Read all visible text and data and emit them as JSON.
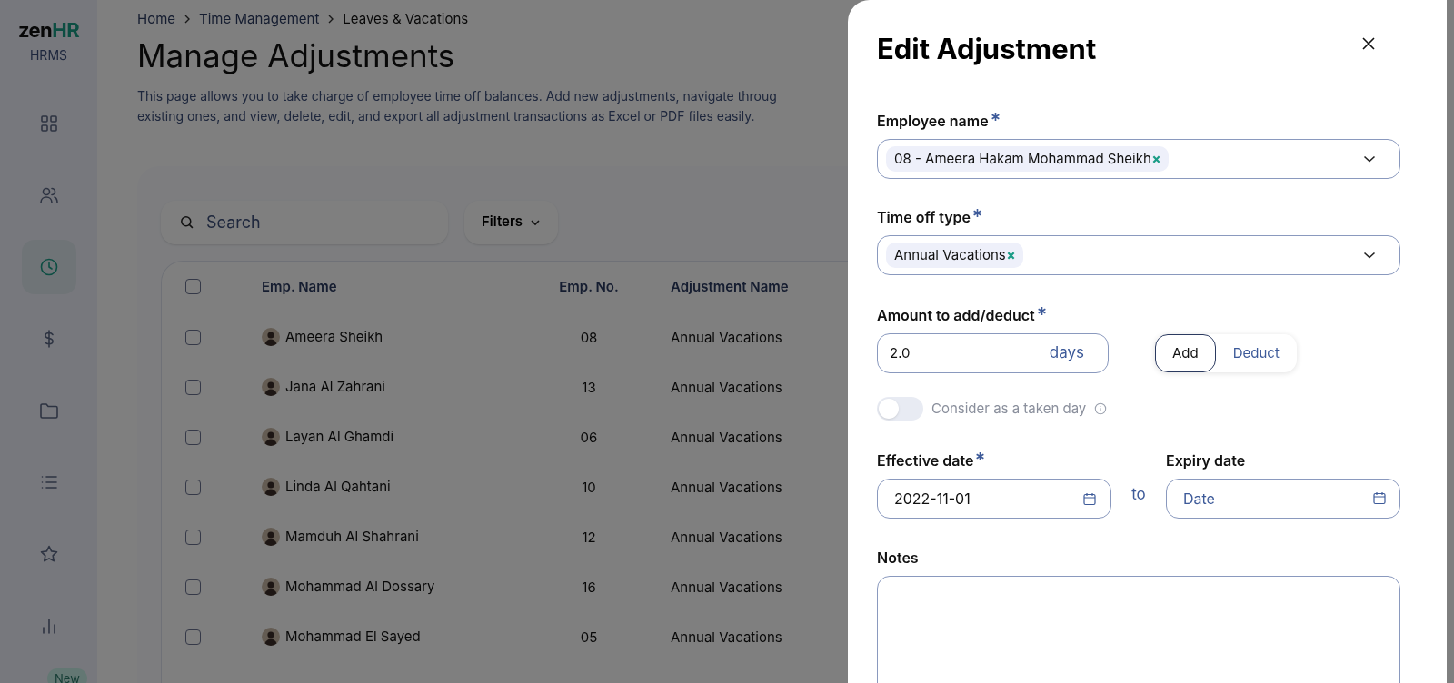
{
  "sidebar": {
    "logo": {
      "brand_dark": "zen",
      "brand_accent": "HR",
      "subtitle": "HRMS"
    },
    "items": [
      {
        "kind": "grid",
        "selected": false
      },
      {
        "kind": "people",
        "selected": false
      },
      {
        "kind": "clock",
        "selected": true
      },
      {
        "kind": "dollar",
        "selected": false
      },
      {
        "kind": "folder",
        "selected": false
      },
      {
        "kind": "list",
        "selected": false
      },
      {
        "kind": "star",
        "selected": false
      },
      {
        "kind": "chart",
        "selected": false
      }
    ],
    "badge": "New"
  },
  "breadcrumb": [
    "Home",
    "Time Management",
    "Leaves & Vacations"
  ],
  "page_title": "Manage Adjustments",
  "description": "This page allows you to take charge of employee time off balances. Add new adjustments, navigate throug\nexisting ones, and view, delete, edit, and export all adjustment transactions as Excel or PDF files easily.",
  "search": {
    "placeholder": "Search"
  },
  "filters_button": "Filters",
  "table": {
    "select_all_checked": false,
    "columns": [
      "Emp. Name",
      "Emp. No.",
      "Adjustment Name"
    ],
    "rows": [
      {
        "name": "Ameera Sheikh",
        "number": "08",
        "adjustment": "Annual Vacations",
        "checked": false
      },
      {
        "name": "Jana Al Zahrani",
        "number": "13",
        "adjustment": "Annual Vacations",
        "checked": false
      },
      {
        "name": "Layan Al Ghamdi",
        "number": "06",
        "adjustment": "Annual Vacations",
        "checked": false
      },
      {
        "name": "Linda Al Qahtani",
        "number": "10",
        "adjustment": "Annual Vacations",
        "checked": false
      },
      {
        "name": "Mamduh Al Shahrani",
        "number": "12",
        "adjustment": "Annual Vacations",
        "checked": false
      },
      {
        "name": "Mohammad Al Dossary",
        "number": "16",
        "adjustment": "Annual Vacations",
        "checked": false
      },
      {
        "name": "Mohammad El Sayed",
        "number": "05",
        "adjustment": "Annual Vacations",
        "checked": false
      }
    ]
  },
  "drawer": {
    "title": "Edit Adjustment",
    "employee": {
      "label": "Employee name",
      "required": true,
      "tag": "08 - Ameera Hakam Mohammad Sheikh"
    },
    "time_off_type": {
      "label": "Time off type",
      "required": true,
      "tag": "Annual Vacations"
    },
    "amount": {
      "label": "Amount to add/deduct",
      "required": true,
      "value": "2.0",
      "unit": "days"
    },
    "mode": [
      {
        "label": "Add",
        "selected": true
      },
      {
        "label": "Deduct",
        "selected": false
      }
    ],
    "taken_day": {
      "label": "Consider as a taken day",
      "on": false
    },
    "effective_date": {
      "label": "Effective date",
      "required": true,
      "value": "2022-11-01"
    },
    "to": "to",
    "expiry_date": {
      "label": "Expiry date",
      "required": false,
      "placeholder": "Date"
    },
    "notes": {
      "label": "Notes"
    }
  }
}
